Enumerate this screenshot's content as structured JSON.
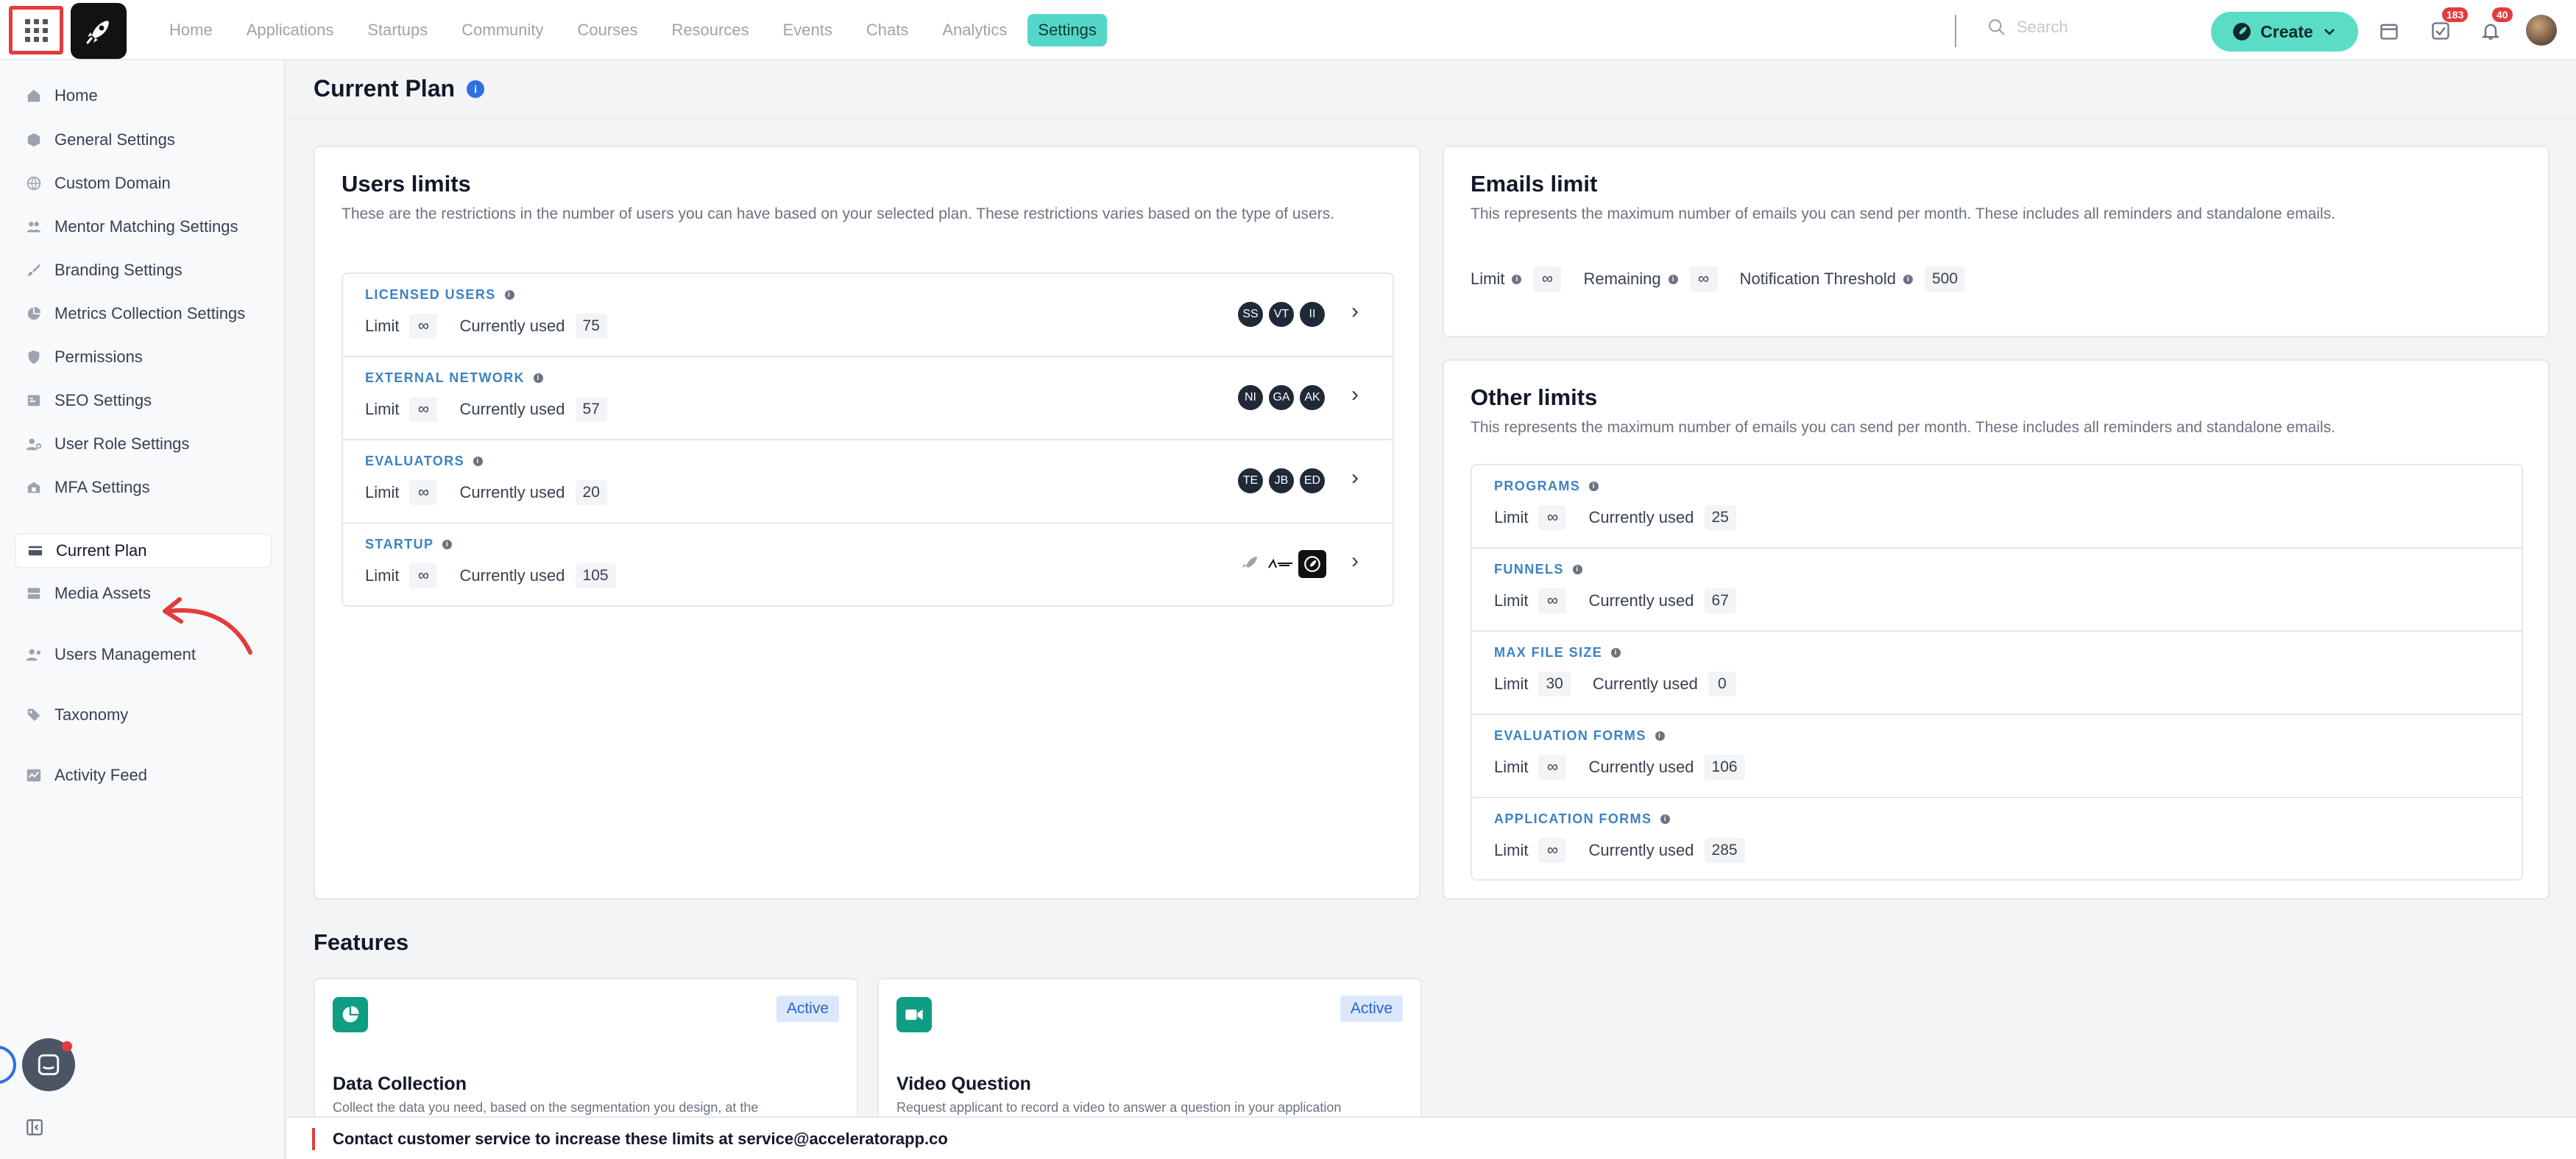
{
  "topbar": {
    "nav": [
      "Home",
      "Applications",
      "Startups",
      "Community",
      "Courses",
      "Resources",
      "Events",
      "Chats",
      "Analytics",
      "Settings"
    ],
    "active_nav": "Settings",
    "search_placeholder": "Search",
    "create_label": "Create",
    "tasks_badge": "183",
    "notifications_badge": "40",
    "icons": [
      "apps-grid-icon",
      "calendar-icon",
      "tasks-icon",
      "bell-icon"
    ]
  },
  "sidebar": {
    "items": [
      {
        "label": "Home",
        "icon": "home-icon"
      },
      {
        "label": "General Settings",
        "icon": "cube-icon"
      },
      {
        "label": "Custom Domain",
        "icon": "globe-icon"
      },
      {
        "label": "Mentor Matching Settings",
        "icon": "users-icon"
      },
      {
        "label": "Branding Settings",
        "icon": "brush-icon"
      },
      {
        "label": "Metrics Collection Settings",
        "icon": "chart-pie-icon"
      },
      {
        "label": "Permissions",
        "icon": "shield-icon"
      },
      {
        "label": "SEO Settings",
        "icon": "seo-icon"
      },
      {
        "label": "User Role Settings",
        "icon": "user-gear-icon"
      },
      {
        "label": "MFA Settings",
        "icon": "mfa-icon"
      },
      {
        "label": "Current Plan",
        "icon": "card-icon"
      },
      {
        "label": "Media Assets",
        "icon": "media-icon"
      },
      {
        "label": "Users Management",
        "icon": "users-manage-icon"
      },
      {
        "label": "Taxonomy",
        "icon": "tag-icon"
      },
      {
        "label": "Activity Feed",
        "icon": "activity-icon"
      }
    ],
    "active": "Current Plan"
  },
  "page": {
    "title": "Current Plan",
    "users_limits": {
      "title": "Users limits",
      "desc": "These are the restrictions in the number of users you can have based on your selected plan. These restrictions varies based on the type of users.",
      "rows": [
        {
          "name": "LICENSED USERS",
          "limit_label": "Limit",
          "limit": "∞",
          "used_label": "Currently used",
          "used": "75",
          "avatars": [
            "SS",
            "VT",
            "II"
          ]
        },
        {
          "name": "EXTERNAL NETWORK",
          "limit_label": "Limit",
          "limit": "∞",
          "used_label": "Currently used",
          "used": "57",
          "avatars": [
            "NI",
            "GA",
            "AK"
          ]
        },
        {
          "name": "EVALUATORS",
          "limit_label": "Limit",
          "limit": "∞",
          "used_label": "Currently used",
          "used": "20",
          "avatars": [
            "TE",
            "JB",
            "ED"
          ]
        },
        {
          "name": "STARTUP",
          "limit_label": "Limit",
          "limit": "∞",
          "used_label": "Currently used",
          "used": "105",
          "avatars": []
        }
      ]
    },
    "emails_limit": {
      "title": "Emails limit",
      "desc": "This represents the maximum number of emails you can send per month. These includes all reminders and standalone emails.",
      "limit_label": "Limit",
      "limit": "∞",
      "remaining_label": "Remaining",
      "remaining": "∞",
      "threshold_label": "Notification Threshold",
      "threshold": "500"
    },
    "other_limits": {
      "title": "Other limits",
      "desc": "This represents the maximum number of emails you can send per month. These includes all reminders and standalone emails.",
      "rows": [
        {
          "name": "PROGRAMS",
          "limit_label": "Limit",
          "limit": "∞",
          "used_label": "Currently used",
          "used": "25"
        },
        {
          "name": "FUNNELS",
          "limit_label": "Limit",
          "limit": "∞",
          "used_label": "Currently used",
          "used": "67"
        },
        {
          "name": "MAX FILE SIZE",
          "limit_label": "Limit",
          "limit": "30",
          "used_label": "Currently used",
          "used": "0"
        },
        {
          "name": "EVALUATION FORMS",
          "limit_label": "Limit",
          "limit": "∞",
          "used_label": "Currently used",
          "used": "106"
        },
        {
          "name": "APPLICATION FORMS",
          "limit_label": "Limit",
          "limit": "∞",
          "used_label": "Currently used",
          "used": "285"
        }
      ]
    },
    "features": {
      "title": "Features",
      "cards": [
        {
          "title": "Data Collection",
          "desc": "Collect the data you need, based on the segmentation you design, at the",
          "badge": "Active"
        },
        {
          "title": "Video Question",
          "desc": "Request applicant to record a video to answer a question in your application",
          "badge": "Active"
        }
      ]
    },
    "footer_text": "Contact customer service to increase these limits at service@acceleratorapp.co"
  },
  "colors": {
    "accent": "#54d6c8",
    "link": "#3b82c4",
    "alert": "#e23c3c",
    "feature_icon": "#0f9d84"
  }
}
